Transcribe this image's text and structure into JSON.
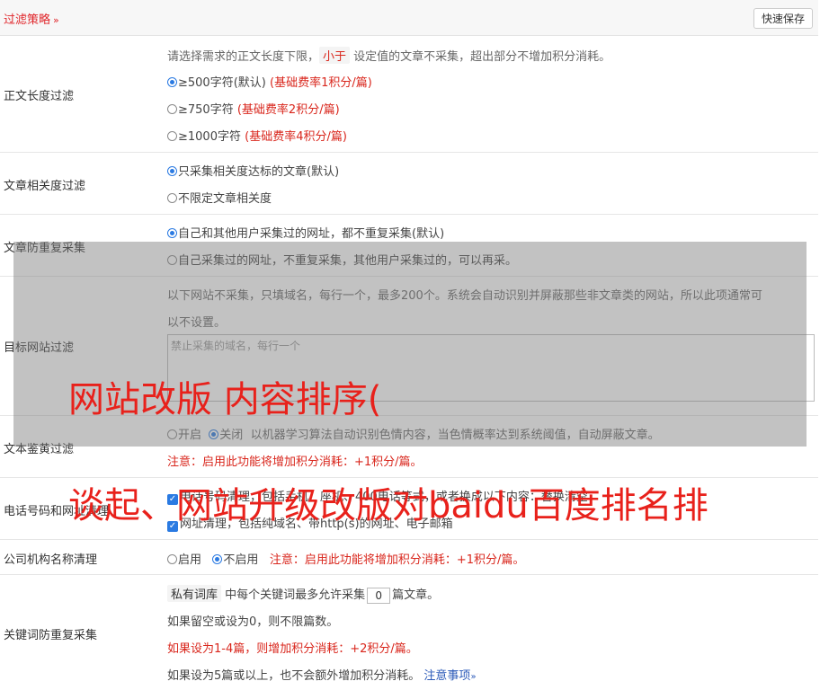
{
  "header": {
    "title": "过滤策略",
    "chevron": "»",
    "save_label": "快速保存"
  },
  "length_filter": {
    "label": "正文长度过滤",
    "desc_pre": "请选择需求的正文长度下限，",
    "desc_tag": "小于",
    "desc_post": "设定值的文章不采集，超出部分不增加积分消耗。",
    "options": [
      {
        "text": "≥500字符(默认)",
        "note": "(基础费率1积分/篇)",
        "selected": true
      },
      {
        "text": "≥750字符",
        "note": "(基础费率2积分/篇)",
        "selected": false
      },
      {
        "text": "≥1000字符",
        "note": "(基础费率4积分/篇)",
        "selected": false
      }
    ]
  },
  "relevance_filter": {
    "label": "文章相关度过滤",
    "options": [
      {
        "text": "只采集相关度达标的文章(默认)",
        "selected": true
      },
      {
        "text": "不限定文章相关度",
        "selected": false
      }
    ]
  },
  "dedup": {
    "label": "文章防重复采集",
    "options": [
      {
        "text": "自己和其他用户采集过的网址，都不重复采集(默认)",
        "selected": true
      },
      {
        "text": "自己采集过的网址，不重复采集，其他用户采集过的，可以再采。",
        "selected": false
      }
    ]
  },
  "site_filter": {
    "label": "目标网站过滤",
    "desc_line1": "以下网站不采集，只填域名，每行一个，最多200个。系统会自动识别并屏蔽那些非文章类的网站，所以此项通常可",
    "desc_line2": "以不设置。",
    "placeholder": "禁止采集的域名，每行一个"
  },
  "porn_filter": {
    "label": "文本鉴黄过滤",
    "on_label": "开启",
    "off_label": "关闭",
    "desc": "以机器学习算法自动识别色情内容，当色情概率达到系统阈值，自动屏蔽文章。",
    "note": "注意：启用此功能将增加积分消耗：+1积分/篇。"
  },
  "contact_filter": {
    "label": "电话号码和网址清理",
    "item1": "电话号码清理，包括手机、座机、400电话等式，或者换成以下内容：替换清空",
    "item2": "网址清理，包括纯域名、带http(s)的网址、电子邮箱"
  },
  "company_filter": {
    "label": "公司机构名称清理",
    "on_label": "启用",
    "off_label": "不启用",
    "note": "注意：启用此功能将增加积分消耗：+1积分/篇。"
  },
  "keyword_dedup": {
    "label": "关键词防重复采集",
    "tag": "私有词库",
    "line1_pre": "中每个关键词最多允许采集",
    "count": "0",
    "line1_post": "篇文章。",
    "line2": "如果留空或设为0，则不限篇数。",
    "line3": "如果设为1-4篇，则增加积分消耗：+2积分/篇。",
    "line4": "如果设为5篇或以上，也不会额外增加积分消耗。",
    "notes_link": "注意事项",
    "notes_chevron": "»"
  },
  "watermark": {
    "line1": "网站改版 内容排序(",
    "line2": "谈起、网站升级改版对baidu百度排名排"
  },
  "colors": {
    "accent": "#e0262b",
    "radio": "#2a7ae2",
    "link": "#2a59b8"
  }
}
